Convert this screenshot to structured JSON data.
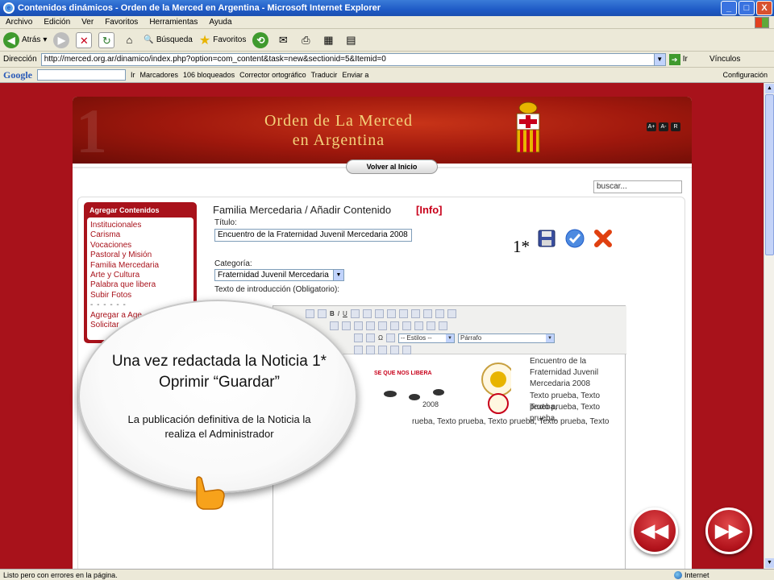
{
  "window": {
    "title": "Contenidos dinámicos - Orden de la Merced en Argentina - Microsoft Internet Explorer",
    "controls": [
      "_",
      "□",
      "X"
    ]
  },
  "menu": [
    "Archivo",
    "Edición",
    "Ver",
    "Favoritos",
    "Herramientas",
    "Ayuda"
  ],
  "toolbar": {
    "back": "Atrás",
    "search": "Búsqueda",
    "favorites": "Favoritos"
  },
  "address": {
    "label": "Dirección",
    "url": "http://merced.org.ar/dinamico/index.php?option=com_content&task=new&sectionid=5&Itemid=0",
    "go": "Ir",
    "links": "Vínculos"
  },
  "google_toolbar": {
    "logo": "Google",
    "go": "Ir",
    "bookmarks": "Marcadores",
    "blocked": "106 bloqueados",
    "spellcheck": "Corrector ortográfico",
    "translate": "Traducir",
    "send": "Enviar a",
    "settings": "Configuración"
  },
  "site": {
    "title_line1": "Orden de La Merced",
    "title_line2": "en Argentina",
    "font_buttons": [
      "A+",
      "A-",
      "R"
    ],
    "home_button": "Volver al Inicio",
    "search_placeholder": "buscar..."
  },
  "side_menu": {
    "header": "Agregar Contenidos",
    "items": [
      "Institucionales",
      "Carisma",
      "Vocaciones",
      "Pastoral y Misión",
      "Familia Mercedaria",
      "Arte y Cultura",
      "Palabra que libera",
      "Subir Fotos"
    ],
    "separator": "- - - - - -",
    "extra_items": [
      "Agregar a Age",
      "Solicitar"
    ]
  },
  "form": {
    "heading": "Familia Mercedaria / Añadir  Contenido",
    "info": "[Info]",
    "title_label": "Título:",
    "title_value": "Encuentro de la Fraternidad Juvenil Mercedaria 2008",
    "category_label": "Categoría:",
    "category_value": "Fraternidad Juvenil Mercedaria",
    "intro_label": "Texto de introducción (Obligatorio):",
    "step_marker": "1*"
  },
  "editor": {
    "style_select": "-- Estilos --",
    "format_select": "Párrafo",
    "caption": "Encuentro de la Fraternidad Juvenil Mercedaria 2008",
    "body_text_1": "Texto prueba, Texto prueba,",
    "body_text_2": "Texto prueba, Texto prueba,",
    "body_text_3": "rueba, Texto prueba, Texto prueba, Texto prueba, Texto",
    "logo_text": "SE QUE NOS LIBERA",
    "year": "2008"
  },
  "callout": {
    "title": "Una vez redactada la Noticia 1* Oprimir “Guardar”",
    "note": "La publicación definitiva de la Noticia la realiza el Administrador"
  },
  "status": {
    "text": "Listo pero con errores en la página.",
    "zone": "Internet"
  }
}
